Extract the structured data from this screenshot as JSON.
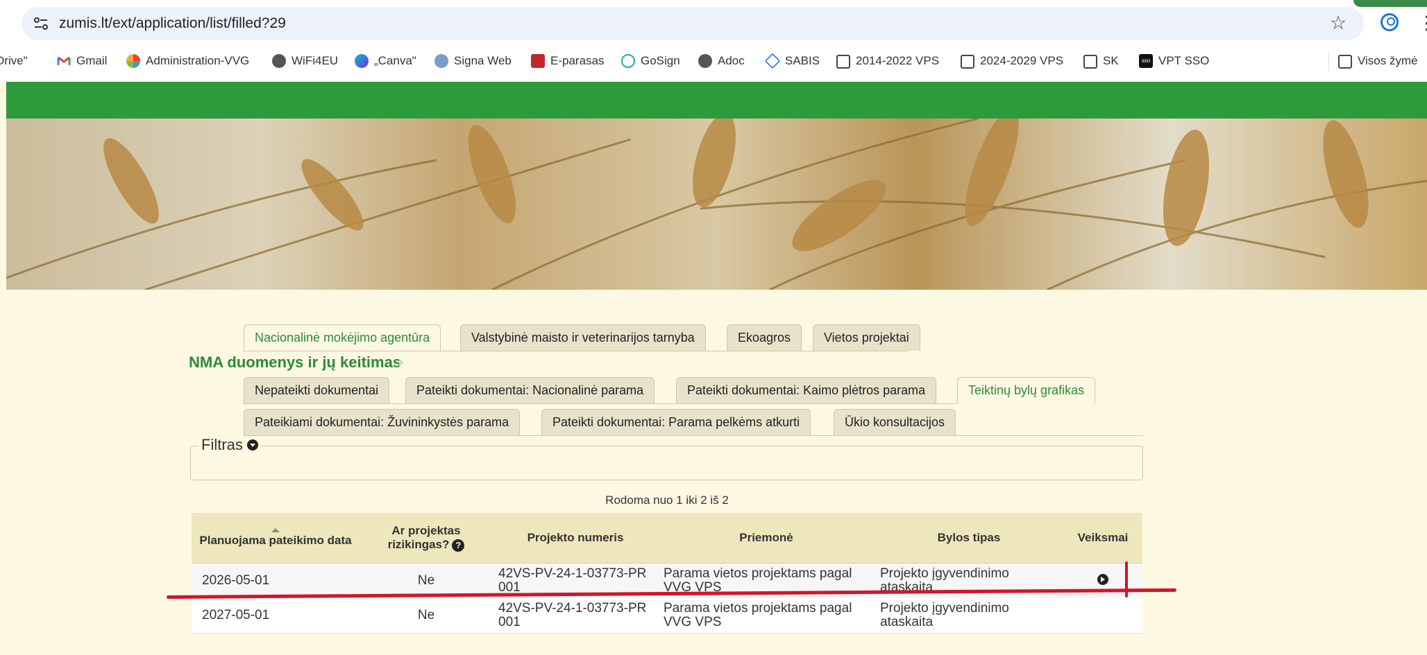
{
  "browser": {
    "url": "zumis.lt/ext/application/list/filled?29",
    "bookmarks": [
      {
        "label": "Drive\"",
        "icon": "drive-icon"
      },
      {
        "label": "Gmail",
        "icon": "gmail-icon"
      },
      {
        "label": "Administration-VVG",
        "icon": "joomla-icon"
      },
      {
        "label": "WiFi4EU",
        "icon": "globe-icon"
      },
      {
        "label": "„Canva\"",
        "icon": "canva-icon"
      },
      {
        "label": "Signa Web",
        "icon": "signa-icon"
      },
      {
        "label": "E-parasas",
        "icon": "e-parasas-icon"
      },
      {
        "label": "GoSign",
        "icon": "gosign-icon"
      },
      {
        "label": "Adoc",
        "icon": "globe-icon"
      },
      {
        "label": "SABIS",
        "icon": "sabis-icon"
      },
      {
        "label": "2014-2022 VPS",
        "icon": "folder-icon"
      },
      {
        "label": "2024-2029 VPS",
        "icon": "folder-icon"
      },
      {
        "label": "SK",
        "icon": "folder-icon"
      },
      {
        "label": "VPT SSO",
        "icon": "sso-icon"
      }
    ],
    "all_bookmarks": "Visos žymė"
  },
  "tabs_top": [
    {
      "label": "Nacionalinė mokėjimo agentūra",
      "active": true
    },
    {
      "label": "Valstybinė maisto ir veterinarijos tarnyba",
      "active": false
    },
    {
      "label": "Ekoagros",
      "active": false
    },
    {
      "label": "Vietos projektai",
      "active": false
    }
  ],
  "section_title": "NMA duomenys ir jų keitimas",
  "tabs_row1": [
    {
      "label": "Nepateikti dokumentai",
      "active": false
    },
    {
      "label": "Pateikti dokumentai: Nacionalinė parama",
      "active": false
    },
    {
      "label": "Pateikti dokumentai: Kaimo plėtros parama",
      "active": false
    },
    {
      "label": "Teiktinų bylų grafikas",
      "active": true
    }
  ],
  "tabs_row2": [
    {
      "label": "Pateikiami dokumentai: Žuvininkystės parama",
      "active": false
    },
    {
      "label": "Pateikti dokumentai: Parama pelkėms atkurti",
      "active": false
    },
    {
      "label": "Ūkio konsultacijos",
      "active": false
    }
  ],
  "filter": {
    "label": "Filtras"
  },
  "showing": "Rodoma nuo 1 iki 2 iš 2",
  "table": {
    "headers": [
      "Planuojama pateikimo data",
      "Ar projektas rizikingas?",
      "Projekto numeris",
      "Priemonė",
      "Bylos tipas",
      "Veiksmai"
    ],
    "rows": [
      [
        "2026-05-01",
        "Ne",
        "42VS-PV-24-1-03773-PR001",
        "Parama vietos projektams pagal VVG VPS",
        "Projekto įgyvendinimo ataskaita",
        ""
      ],
      [
        "2027-05-01",
        "Ne",
        "42VS-PV-24-1-03773-PR001",
        "Parama vietos projektams pagal VVG VPS",
        "Projekto įgyvendinimo ataskaita",
        ""
      ]
    ]
  },
  "colors": {
    "green_header": "#2d9a3b",
    "background": "#fdf8e2",
    "annotation_red": "#d2152b"
  }
}
